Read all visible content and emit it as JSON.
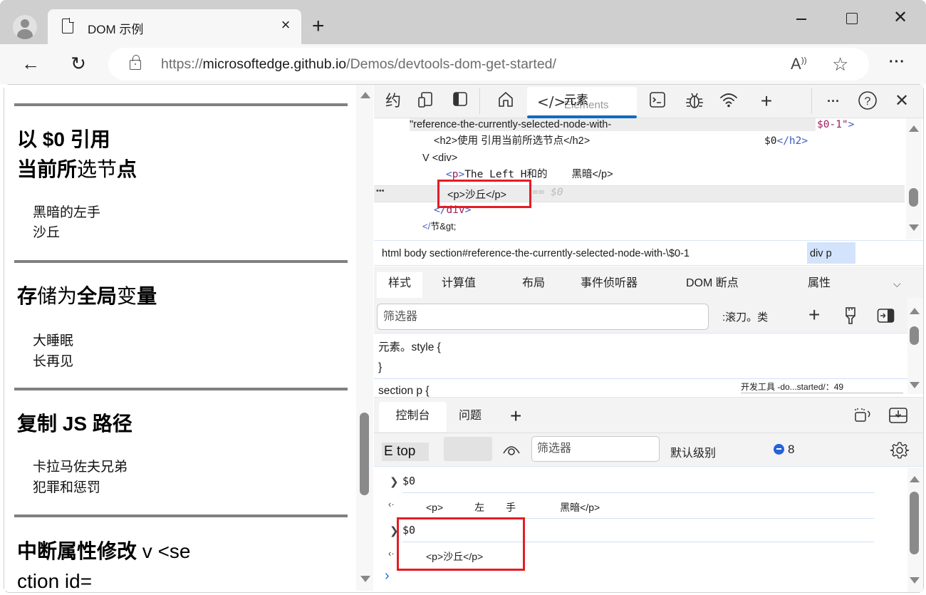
{
  "browser": {
    "tab_title": "DOM 示例",
    "url_prefix": "https://",
    "url_domain": "microsoftedge.github.io",
    "url_path": "/Demos/devtools-dom-get-started/",
    "new_tab_label": "+",
    "close_tab": "×",
    "more": "···",
    "read_aloud": "A⁾",
    "favorite": "☆",
    "back": "←",
    "reload": "↻"
  },
  "page": {
    "sections": [
      {
        "heading_bold": "以 $0 引用",
        "heading_line2_bold": "当前所",
        "heading_line2_light": "选节",
        "heading_line2_tail": "点",
        "items": [
          "黑暗的左手",
          "沙丘"
        ]
      },
      {
        "heading_a": "存",
        "heading_b": "储为",
        "heading_c": "全局",
        "heading_d": "变",
        "heading_e": "量",
        "items": [
          "大睡眠",
          "长再见"
        ]
      },
      {
        "heading": "复制 JS 路径",
        "items": [
          "卡拉马佐夫兄弟",
          "犯罪和惩罚"
        ]
      },
      {
        "heading_bold": "中断属性修改",
        "heading_tail": " v <se",
        "heading_line2": "ction id="
      }
    ]
  },
  "devtools": {
    "toolbar": {
      "device_label": "约",
      "elements_tab_zh": "元素",
      "elements_tab_en": "Elements",
      "more": "···",
      "help": "?",
      "close": "✕"
    },
    "dom_tree": {
      "line1_text": "\"reference-the-currently-selected-node-with-",
      "line1_tail_value": "$0-1",
      "line1_tail_quote": "\"",
      "line1_tail_bracket": ">",
      "line2_open": "<h2>使用 引用当前所选节点</h2>",
      "line2_tail_text": "$0",
      "line2_tail_tag": "</h2>",
      "line3": "V <div>",
      "line4_open_bracket": "<",
      "line4_tag": "p",
      "line4_close_bracket": ">",
      "line4_text": "The Left H和的",
      "line4_tail": "黑暗</p>",
      "selected_node": "<p>沙丘</p>",
      "selected_suffix": "== $0",
      "row_dots": "•••",
      "line6_open": "</",
      "line6_tag": "div",
      "line6_close": ">",
      "line7_open": "</",
      "line7_rest": "节&gt;"
    },
    "breadcrumb": {
      "path": "html body section#reference-the-currently-selected-node-with-\\$0-1",
      "current": "div p"
    },
    "subtabs": [
      "样式",
      "计算值",
      "布局",
      "事件侦听器",
      "DOM 断点",
      "属性"
    ],
    "styles": {
      "filter_placeholder": "筛选器",
      "hov_cls": ":滚刀。类",
      "element_style": "元素。style {",
      "element_style_close": "}",
      "rule_selector": "section p {",
      "source_link": "开发工具 -do...started/：49"
    },
    "drawer": {
      "tabs": [
        "控制台",
        "问题"
      ],
      "add": "+"
    },
    "console_toolbar": {
      "context": "E top",
      "filter_placeholder": "筛选器",
      "levels": "默认级别",
      "message_count": "8"
    },
    "console": {
      "entries": [
        {
          "input": "$0",
          "output_parts": [
            "<p>",
            "左",
            "手",
            "黑暗</p>"
          ]
        },
        {
          "input": "$0",
          "output": "<p>沙丘</p>"
        }
      ],
      "prompt": "›"
    }
  },
  "colors": {
    "accent": "#0f6cbd",
    "highlight_box": "#e31d26",
    "tag_blue": "#3e5cbf",
    "tag_name": "#9b1f5e"
  }
}
